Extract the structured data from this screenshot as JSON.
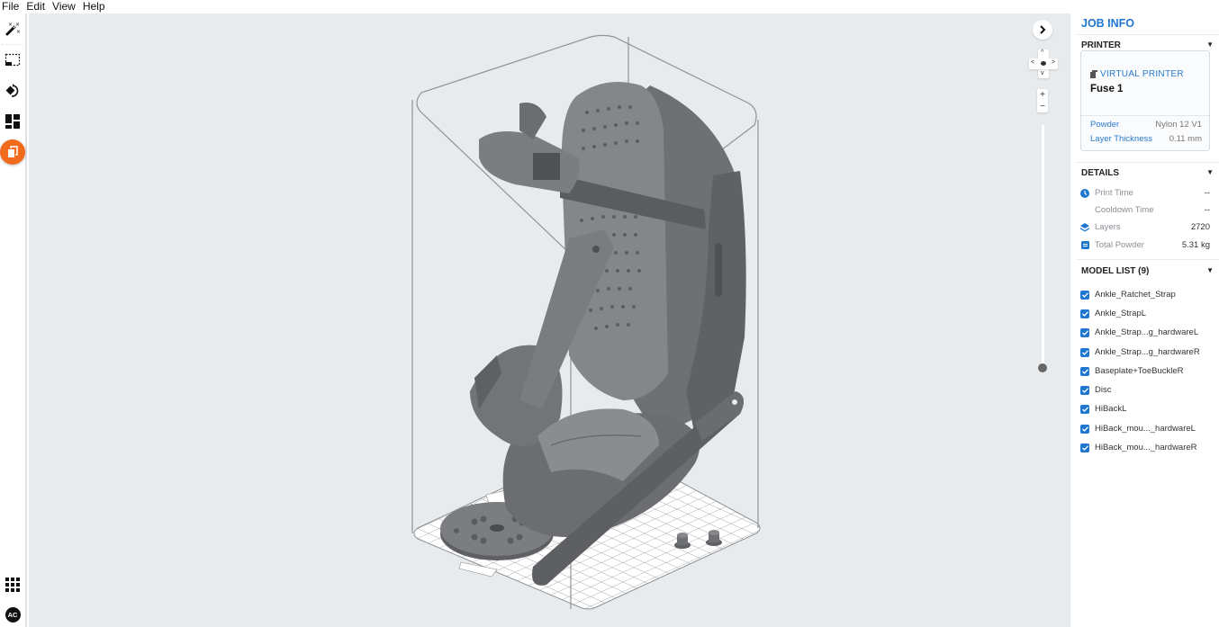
{
  "menu": [
    "File",
    "Edit",
    "View",
    "Help"
  ],
  "toolbar": {
    "tools": [
      {
        "icon": "magic-wand-icon",
        "label": "Auto layout"
      },
      {
        "icon": "selection-box-icon",
        "label": "Select"
      },
      {
        "icon": "orient-icon",
        "label": "Orient"
      },
      {
        "icon": "layout-icon",
        "label": "Layout"
      },
      {
        "icon": "print-icon",
        "label": "Print",
        "active": true
      }
    ],
    "bottom": [
      {
        "icon": "apps-grid-icon"
      },
      {
        "icon": "account-avatar",
        "label": "AC"
      }
    ],
    "accent": "#f26b1d"
  },
  "viewport": {
    "background": "#e8ebee",
    "model_color": "#7a7c80",
    "zoom_slider": {
      "value": 0.0
    }
  },
  "panel": {
    "title": "JOB INFO",
    "printer": {
      "header": "PRINTER",
      "type_label": "VIRTUAL PRINTER",
      "name": "Fuse 1",
      "rows": [
        {
          "key": "Powder",
          "value": "Nylon 12 V1"
        },
        {
          "key": "Layer Thickness",
          "value": "0.11 mm"
        }
      ]
    },
    "details": {
      "header": "DETAILS",
      "rows": [
        {
          "icon": "clock-icon",
          "key": "Print Time",
          "value": "--"
        },
        {
          "icon": "",
          "key": "Cooldown Time",
          "value": "--"
        },
        {
          "icon": "layers-icon",
          "key": "Layers",
          "value": "2720"
        },
        {
          "icon": "powder-icon",
          "key": "Total Powder",
          "value": "5.31 kg"
        }
      ]
    },
    "models": {
      "header": "MODEL LIST (9)",
      "items": [
        {
          "name": "Ankle_Ratchet_Strap",
          "checked": true
        },
        {
          "name": "Ankle_StrapL",
          "checked": true
        },
        {
          "name": "Ankle_Strap...g_hardwareL",
          "checked": true
        },
        {
          "name": "Ankle_Strap...g_hardwareR",
          "checked": true
        },
        {
          "name": "Baseplate+ToeBuckleR",
          "checked": true
        },
        {
          "name": "Disc",
          "checked": true
        },
        {
          "name": "HiBackL",
          "checked": true
        },
        {
          "name": "HiBack_mou..._hardwareL",
          "checked": true
        },
        {
          "name": "HiBack_mou..._hardwareR",
          "checked": true
        }
      ]
    },
    "accent": "#1f77d0"
  }
}
